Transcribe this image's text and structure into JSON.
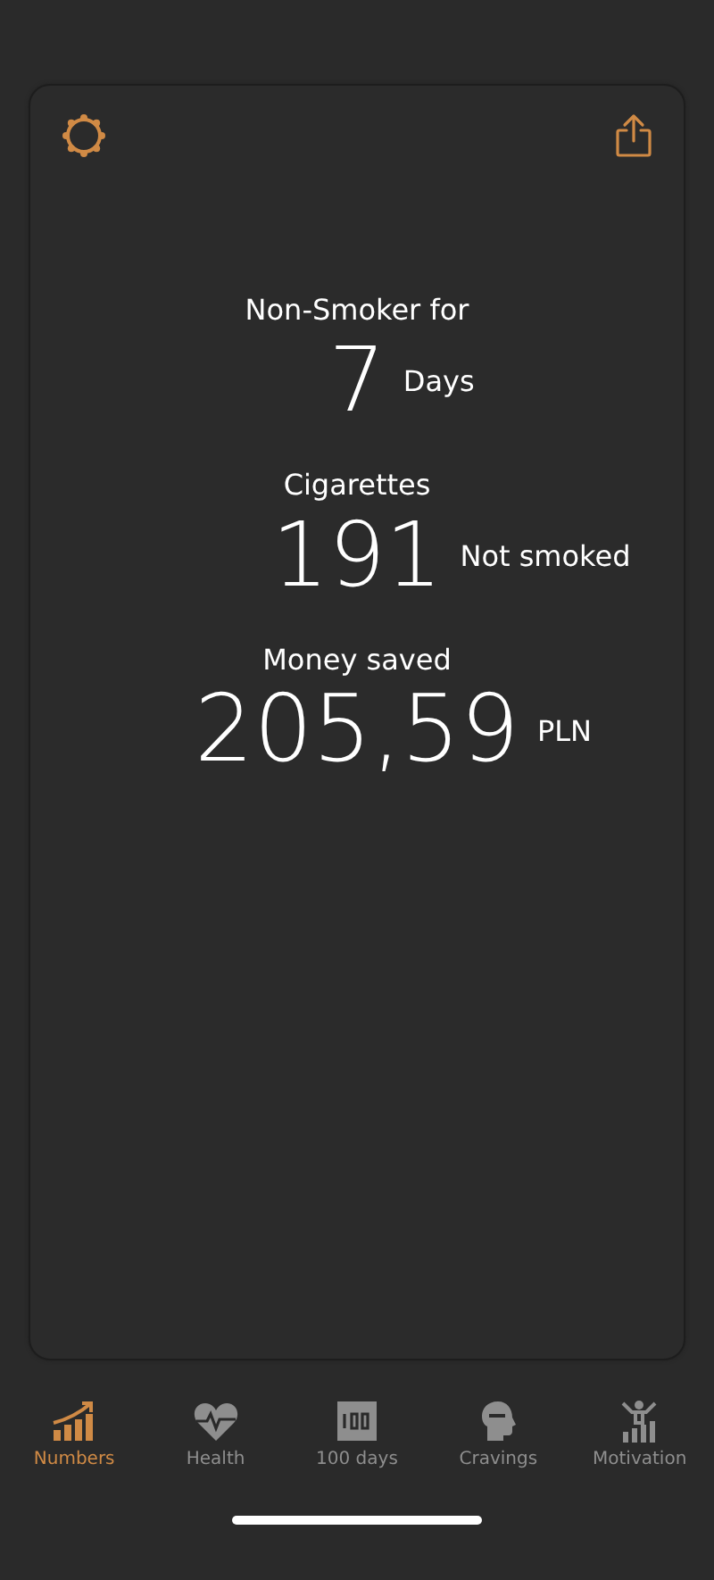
{
  "stats": [
    {
      "label": "Non-Smoker for",
      "value": "7",
      "unit": "Days"
    },
    {
      "label": "Cigarettes",
      "value": "191",
      "unit": "Not smoked"
    },
    {
      "label": "Money saved",
      "value": "205,59",
      "unit": "PLN"
    }
  ],
  "tabs": [
    {
      "label": "Numbers",
      "kind": "chart",
      "selected": true
    },
    {
      "label": "Health",
      "kind": "heart",
      "selected": false
    },
    {
      "label": "100 days",
      "kind": "hundred",
      "selected": false
    },
    {
      "label": "Cravings",
      "kind": "head",
      "selected": false
    },
    {
      "label": "Motivation",
      "kind": "person",
      "selected": false
    }
  ]
}
